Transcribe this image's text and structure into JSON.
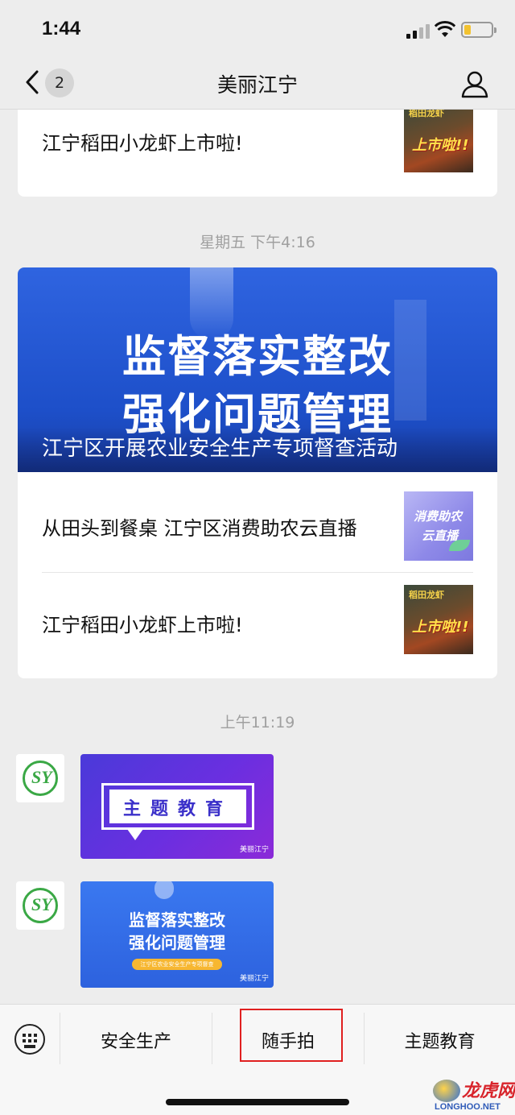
{
  "status_bar": {
    "time": "1:44"
  },
  "nav": {
    "back_count": "2",
    "title": "美丽江宁"
  },
  "feed": {
    "card1": {
      "article_title": "江宁稻田小龙虾上市啦!",
      "thumb_tag1": "稻田龙虾",
      "thumb_tag2": "上市啦!!"
    },
    "timestamp1": "星期五 下午4:16",
    "card2": {
      "banner_line1": "监督落实整改",
      "banner_line2": "强化问题管理",
      "banner_caption": "江宁区开展农业安全生产专项督查活动",
      "article1_title": "从田头到餐桌 江宁区消费助农云直播",
      "article1_thumb_line1": "消费助农",
      "article1_thumb_line2": "云直播",
      "article2_title": "江宁稻田小龙虾上市啦!",
      "article2_thumb_tag1": "稻田龙虾",
      "article2_thumb_tag2": "上市啦!!"
    },
    "timestamp2": "上午11:19",
    "messages": [
      {
        "avatar_mark": "SY",
        "image_text": "主题教育",
        "watermark": "美丽江宁"
      },
      {
        "avatar_mark": "SY",
        "image_line1": "监督落实整改",
        "image_line2": "强化问题管理",
        "image_pill": "江宁区农业安全生产专项督查",
        "watermark": "美丽江宁"
      }
    ]
  },
  "menu": {
    "items": [
      {
        "label": "安全生产"
      },
      {
        "label": "随手拍",
        "selected": true
      },
      {
        "label": "主题教育"
      }
    ],
    "selected_border_color": "#e02020"
  },
  "watermark_logo": {
    "cn": "龙虎网",
    "en": "LONGHOO.NET"
  },
  "colors": {
    "background": "#ededed",
    "banner_blue": "#2f64e0",
    "menu_bg": "#f7f7f7"
  }
}
